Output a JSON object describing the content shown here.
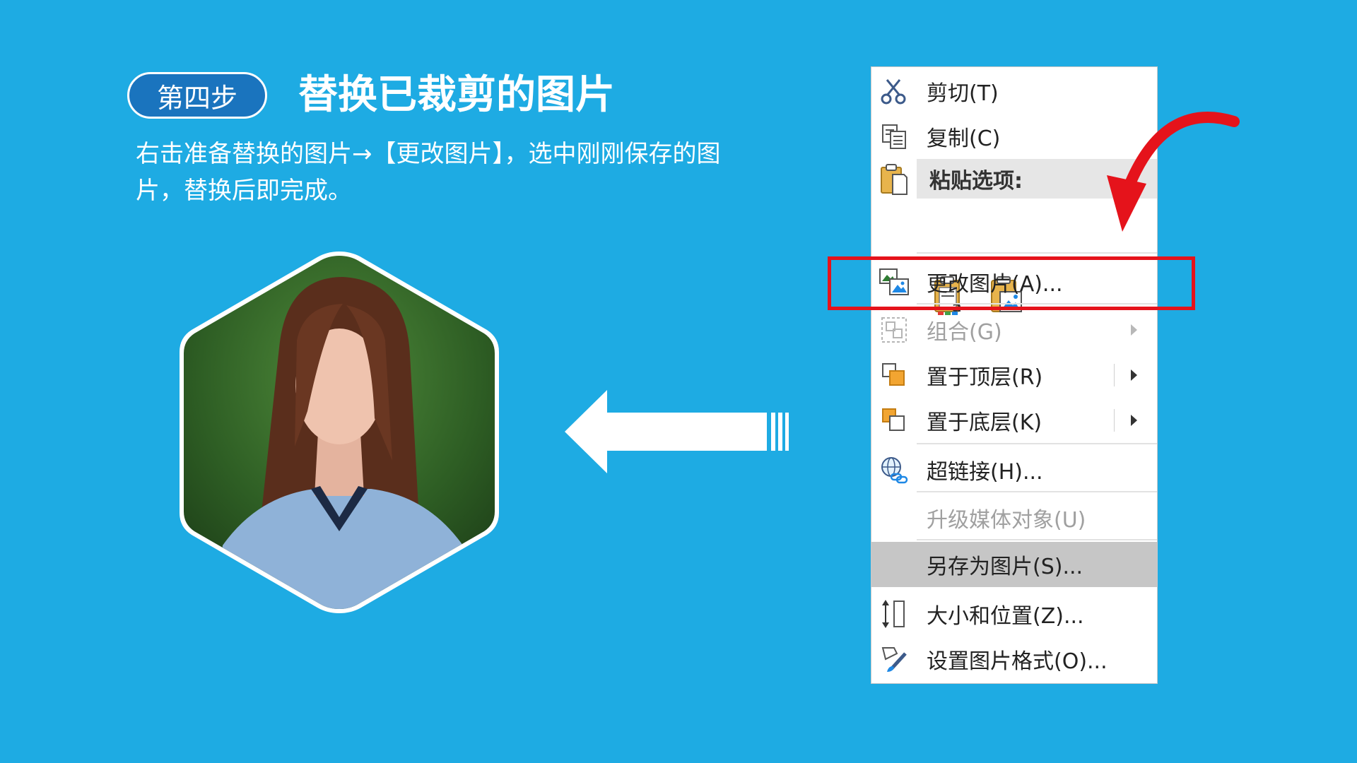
{
  "slide": {
    "step_label": "第四步",
    "title": "替换已裁剪的图片",
    "description": "右击准备替换的图片→【更改图片】，选中刚刚保存的图片，替换后即完成。"
  },
  "colors": {
    "background": "#1eabe3",
    "badge": "#1a74be",
    "highlight": "#e5131b",
    "menu_hover": "#c6c6c6"
  },
  "context_menu": {
    "cut": {
      "label": "剪切(T)",
      "icon": "scissors-icon"
    },
    "copy": {
      "label": "复制(C)",
      "icon": "copy-icon"
    },
    "paste_options": {
      "label": "粘贴选项:",
      "icon": "clipboard-icon"
    },
    "paste_buttons": [
      {
        "name": "paste-text-icon"
      },
      {
        "name": "paste-picture-icon"
      }
    ],
    "change_picture": {
      "label": "更改图片(A)...",
      "icon": "change-picture-icon"
    },
    "group": {
      "label": "组合(G)",
      "icon": "group-icon",
      "disabled": true
    },
    "bring_front": {
      "label": "置于顶层(R)",
      "icon": "bring-front-icon"
    },
    "send_back": {
      "label": "置于底层(K)",
      "icon": "send-back-icon"
    },
    "hyperlink": {
      "label": "超链接(H)...",
      "icon": "hyperlink-icon"
    },
    "upgrade_media": {
      "label": "升级媒体对象(U)",
      "disabled": true
    },
    "save_as_picture": {
      "label": "另存为图片(S)...",
      "hovered": true
    },
    "size_position": {
      "label": "大小和位置(Z)...",
      "icon": "size-position-icon"
    },
    "format_picture": {
      "label": "设置图片格式(O)...",
      "icon": "format-picture-icon"
    }
  }
}
